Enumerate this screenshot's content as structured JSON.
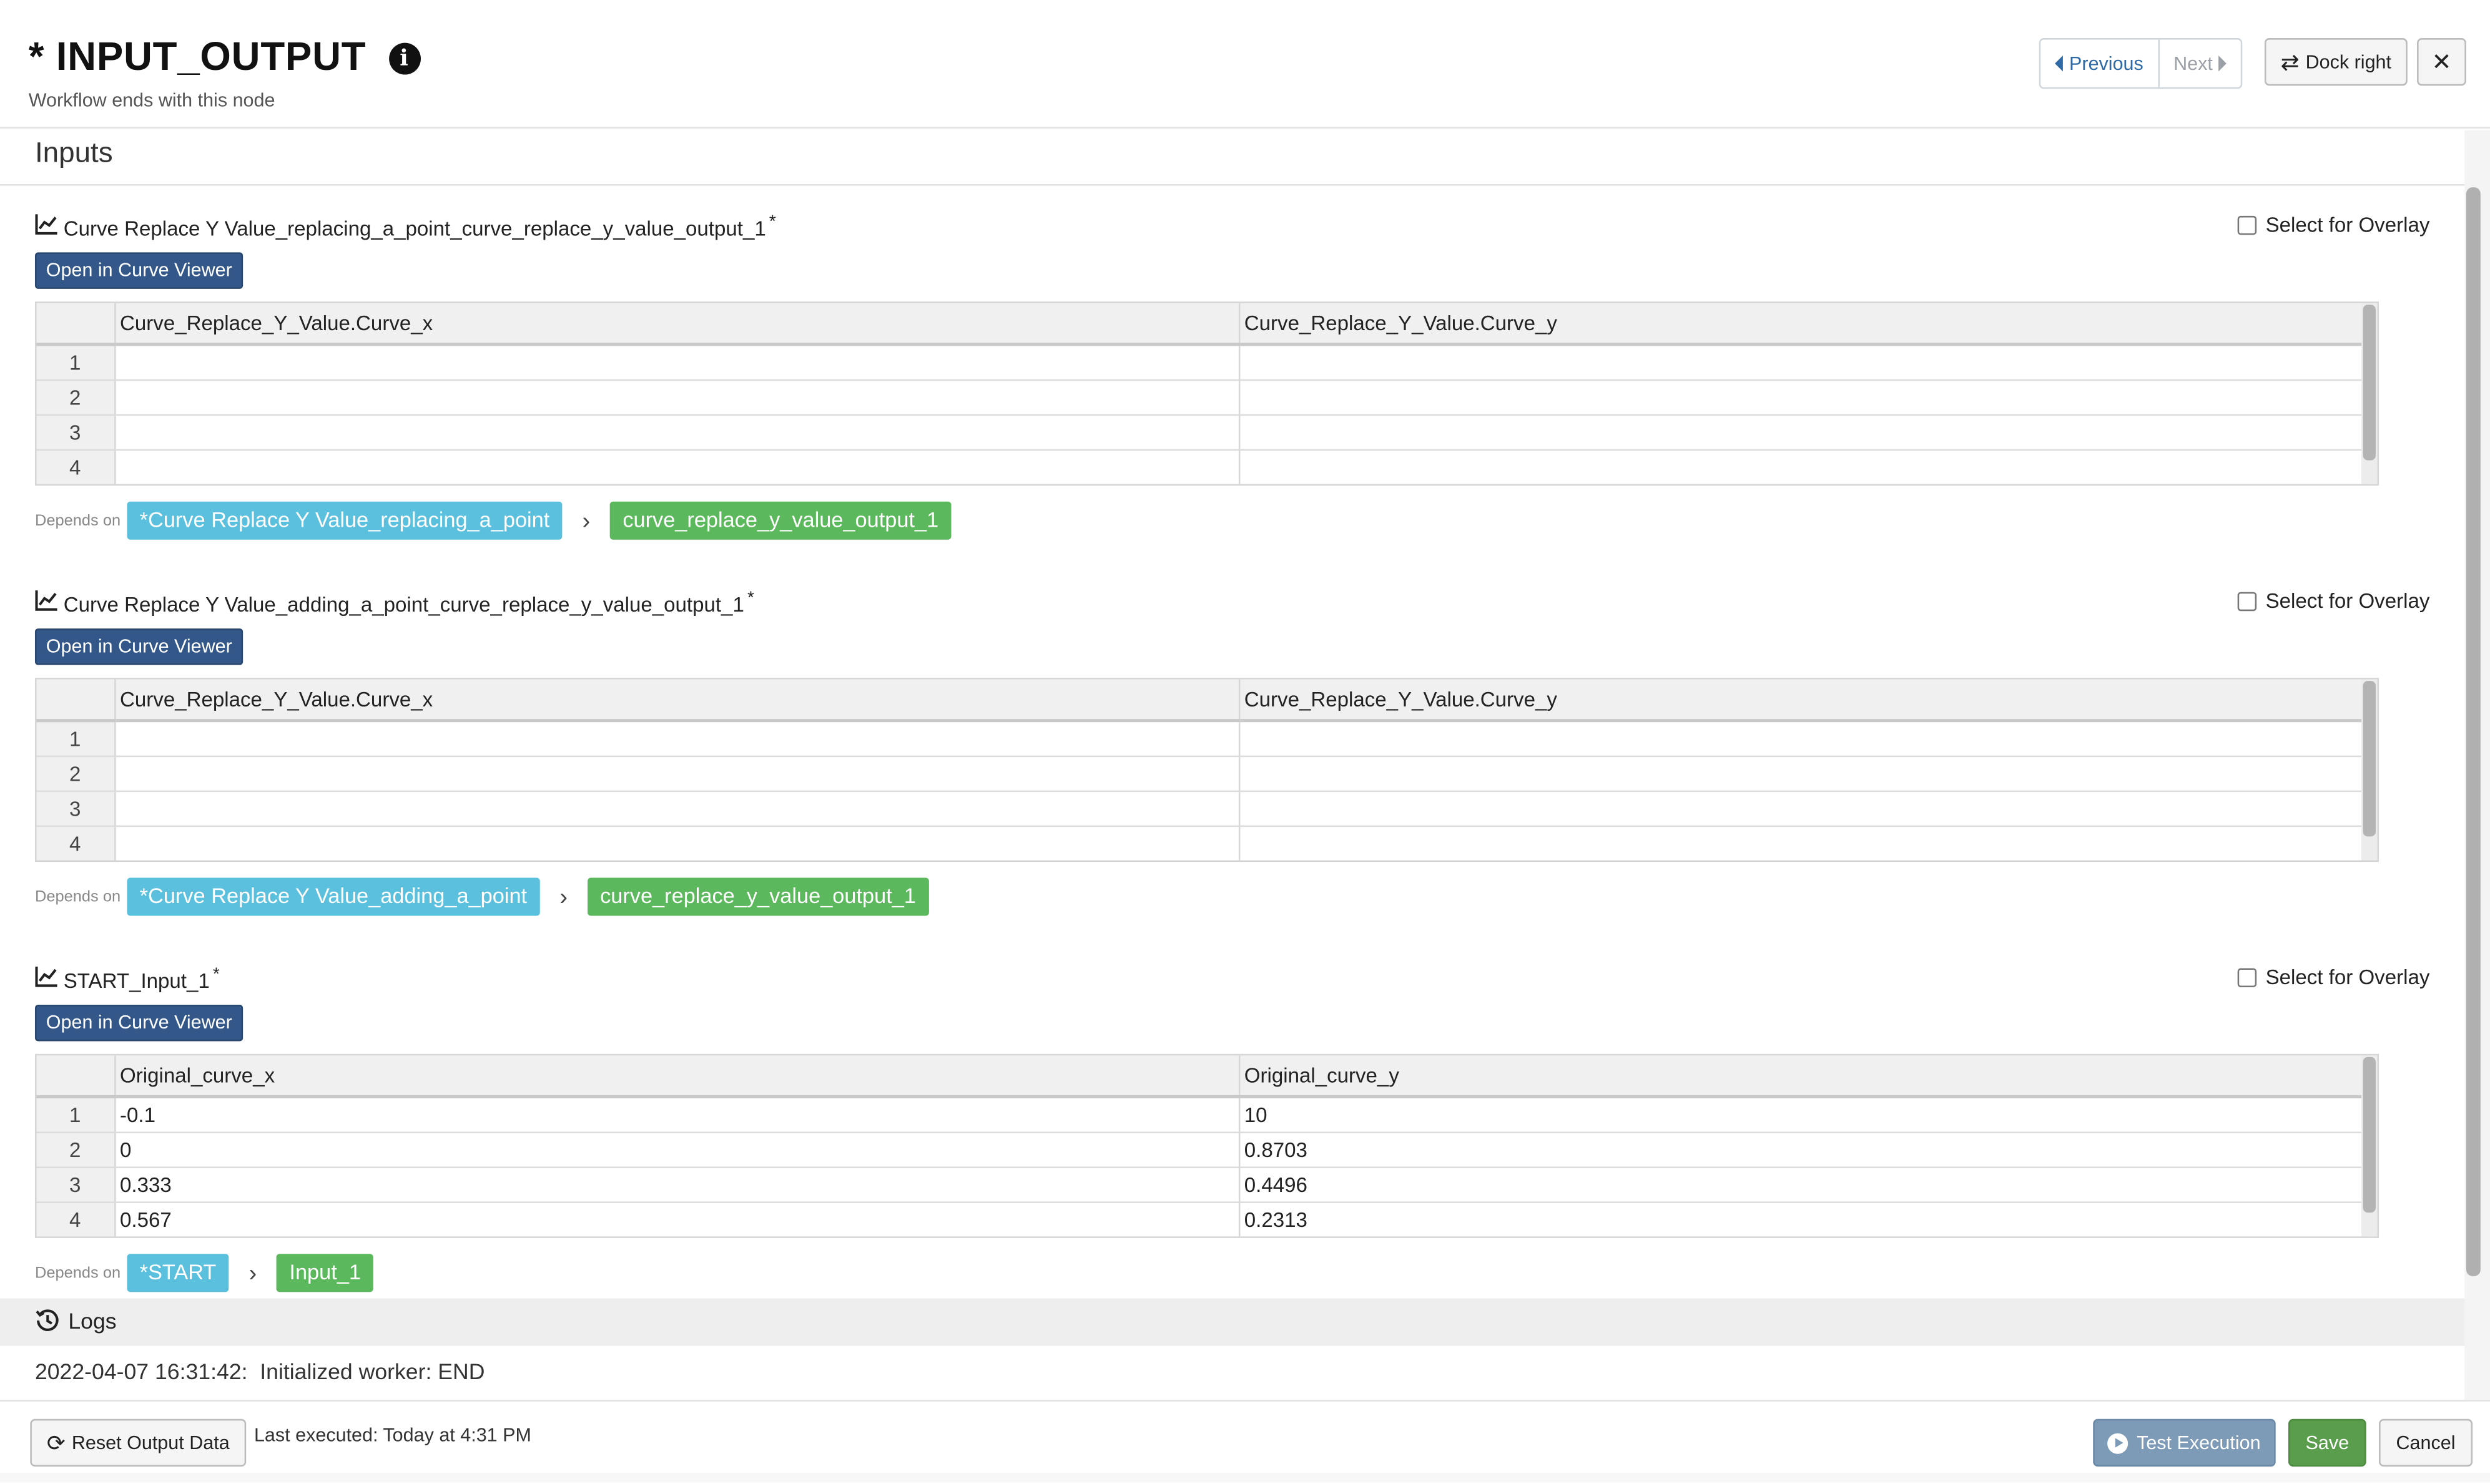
{
  "header": {
    "title": "* INPUT_OUTPUT",
    "subtitle": "Workflow ends with this node",
    "previous_label": "Previous",
    "next_label": "Next",
    "dock_label": "Dock right",
    "close_glyph": "✕"
  },
  "inputs_heading": "Inputs",
  "sections": [
    {
      "title": "Curve Replace Y Value_replacing_a_point_curve_replace_y_value_output_1",
      "required_marker": "*",
      "overlay_label": "Select for Overlay",
      "overlay_checked": false,
      "open_button": "Open in Curve Viewer",
      "columns": [
        "Curve_Replace_Y_Value.Curve_x",
        "Curve_Replace_Y_Value.Curve_y"
      ],
      "row_numbers": [
        "1",
        "2",
        "3",
        "4"
      ],
      "rows": [
        [
          "",
          ""
        ],
        [
          "",
          ""
        ],
        [
          "",
          ""
        ],
        [
          "",
          ""
        ]
      ],
      "depends_label": "Depends on",
      "depends_node": "*Curve Replace Y Value_replacing_a_point",
      "depends_output": "curve_replace_y_value_output_1"
    },
    {
      "title": "Curve Replace Y Value_adding_a_point_curve_replace_y_value_output_1",
      "required_marker": "*",
      "overlay_label": "Select for Overlay",
      "overlay_checked": false,
      "open_button": "Open in Curve Viewer",
      "columns": [
        "Curve_Replace_Y_Value.Curve_x",
        "Curve_Replace_Y_Value.Curve_y"
      ],
      "row_numbers": [
        "1",
        "2",
        "3",
        "4"
      ],
      "rows": [
        [
          "",
          ""
        ],
        [
          "",
          ""
        ],
        [
          "",
          ""
        ],
        [
          "",
          ""
        ]
      ],
      "depends_label": "Depends on",
      "depends_node": "*Curve Replace Y Value_adding_a_point",
      "depends_output": "curve_replace_y_value_output_1"
    },
    {
      "title": "START_Input_1",
      "required_marker": "*",
      "overlay_label": "Select for Overlay",
      "overlay_checked": false,
      "open_button": "Open in Curve Viewer",
      "columns": [
        "Original_curve_x",
        "Original_curve_y"
      ],
      "row_numbers": [
        "1",
        "2",
        "3",
        "4"
      ],
      "rows": [
        [
          "-0.1",
          "10"
        ],
        [
          "0",
          "0.8703"
        ],
        [
          "0.333",
          "0.4496"
        ],
        [
          "0.567",
          "0.2313"
        ]
      ],
      "depends_label": "Depends on",
      "depends_node": "*START",
      "depends_output": "Input_1"
    }
  ],
  "logs": {
    "title": "Logs",
    "lines": [
      "2022-04-07 16:31:42:  Initialized worker: END"
    ]
  },
  "footer": {
    "reset_label": "Reset Output Data",
    "last_executed": "Last executed: Today at 4:31 PM",
    "test_label": "Test Execution",
    "save_label": "Save",
    "cancel_label": "Cancel"
  },
  "colors": {
    "primary_button": "#34578a",
    "node_chip": "#5bc0de",
    "output_chip": "#5cb85c",
    "save": "#5a9e4d",
    "test": "#7d9ab7"
  },
  "icons": {
    "info": "info-icon",
    "swap": "swap-icon",
    "close": "close-icon",
    "chart": "line-chart-icon",
    "history": "history-icon",
    "refresh": "refresh-icon",
    "play": "play-circle-icon"
  }
}
